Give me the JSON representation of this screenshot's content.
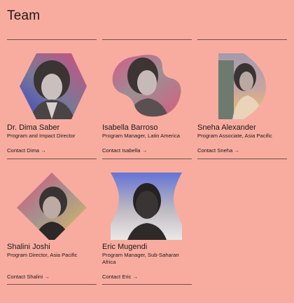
{
  "page": {
    "title": "Team"
  },
  "members": [
    {
      "name": "Dr. Dima Saber",
      "role": "Program and Impact Director",
      "contact": "Contact Dima",
      "arrow": "→"
    },
    {
      "name": "Isabella Barroso",
      "role": "Program Manager, Latin America",
      "contact": "Contact Isabella",
      "arrow": "→"
    },
    {
      "name": "Sneha Alexander",
      "role": "Program Associate, Asia Pacific",
      "contact": "Contact Sneha",
      "arrow": "→"
    },
    {
      "name": "Shalini Joshi",
      "role": "Program Director, Asia Pacific",
      "contact": "Contact Shalini",
      "arrow": "→"
    },
    {
      "name": "Eric Mugendi",
      "role": "Program Manager, Sub-Saharan Africa",
      "contact": "Contact Eric",
      "arrow": "→"
    }
  ],
  "colors": {
    "background": "#f8ac9f",
    "text": "#1f1a19",
    "rule": "#6b514c",
    "gradient_blue": "#4657d9",
    "gradient_pink": "#e64b7c",
    "gradient_yellow": "#f4c64f"
  }
}
